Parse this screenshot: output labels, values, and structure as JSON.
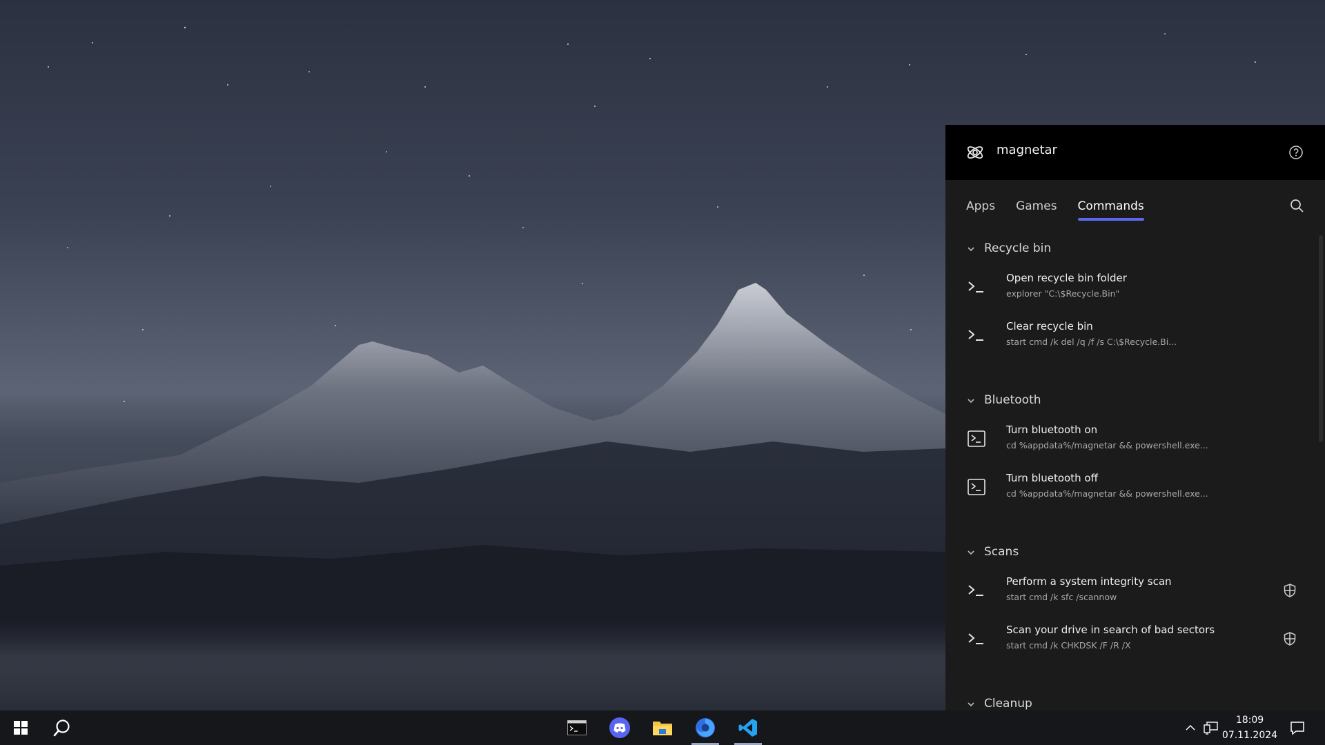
{
  "app": {
    "title": "magnetar",
    "logo_icon": "magnet-atom-icon",
    "help_icon": "help-circle-icon"
  },
  "tabs": [
    {
      "label": "Apps",
      "active": false
    },
    {
      "label": "Games",
      "active": false
    },
    {
      "label": "Commands",
      "active": true
    }
  ],
  "search_icon": "search-icon",
  "accent_color": "#5b67e8",
  "sections": [
    {
      "title": "Recycle bin",
      "items": [
        {
          "title": "Open recycle bin folder",
          "command": "explorer \"C:\\$Recycle.Bin\"",
          "icon": "cmd-prompt-icon",
          "admin": false
        },
        {
          "title": "Clear recycle bin",
          "command": "start cmd /k del /q /f /s C:\\$Recycle.Bi...",
          "icon": "cmd-prompt-icon",
          "admin": false
        }
      ]
    },
    {
      "title": "Bluetooth",
      "items": [
        {
          "title": "Turn bluetooth on",
          "command": "cd %appdata%/magnetar && powershell.exe...",
          "icon": "powershell-icon",
          "admin": false
        },
        {
          "title": "Turn bluetooth off",
          "command": "cd %appdata%/magnetar && powershell.exe...",
          "icon": "powershell-icon",
          "admin": false
        }
      ]
    },
    {
      "title": "Scans",
      "items": [
        {
          "title": "Perform a system integrity scan",
          "command": "start cmd /k sfc /scannow",
          "icon": "cmd-prompt-icon",
          "admin": true
        },
        {
          "title": "Scan your drive in search of bad sectors",
          "command": "start cmd /k CHKDSK /F /R /X",
          "icon": "cmd-prompt-icon",
          "admin": true
        }
      ]
    },
    {
      "title": "Cleanup",
      "items": []
    }
  ],
  "taskbar": {
    "start_icon": "windows-start-icon",
    "search_icon": "search-icon",
    "pinned": [
      {
        "name": "terminal-icon",
        "active": false
      },
      {
        "name": "discord-icon",
        "active": false
      },
      {
        "name": "file-explorer-icon",
        "active": false
      },
      {
        "name": "firefox-icon",
        "active": true
      },
      {
        "name": "vscode-icon",
        "active": true
      }
    ],
    "tray": {
      "time": "18:09",
      "date": "07.11.2024"
    }
  }
}
